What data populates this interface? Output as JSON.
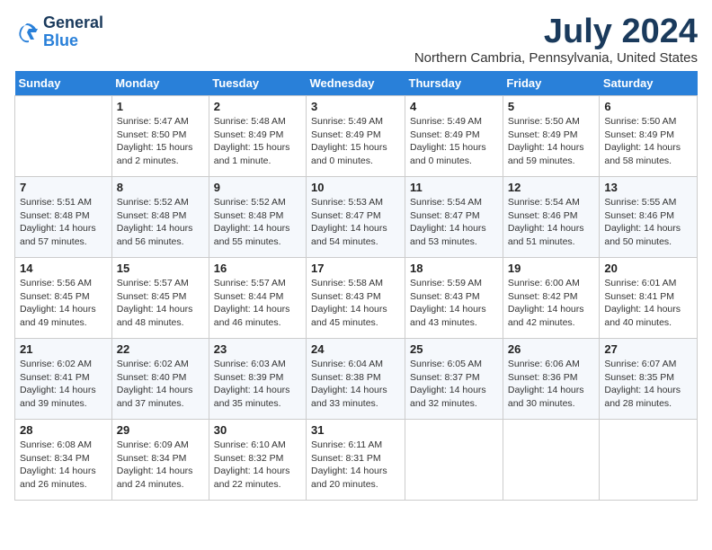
{
  "logo": {
    "general": "General",
    "blue": "Blue"
  },
  "title": "July 2024",
  "location": "Northern Cambria, Pennsylvania, United States",
  "days_of_week": [
    "Sunday",
    "Monday",
    "Tuesday",
    "Wednesday",
    "Thursday",
    "Friday",
    "Saturday"
  ],
  "weeks": [
    [
      {
        "day": "",
        "info": ""
      },
      {
        "day": "1",
        "info": "Sunrise: 5:47 AM\nSunset: 8:50 PM\nDaylight: 15 hours\nand 2 minutes."
      },
      {
        "day": "2",
        "info": "Sunrise: 5:48 AM\nSunset: 8:49 PM\nDaylight: 15 hours\nand 1 minute."
      },
      {
        "day": "3",
        "info": "Sunrise: 5:49 AM\nSunset: 8:49 PM\nDaylight: 15 hours\nand 0 minutes."
      },
      {
        "day": "4",
        "info": "Sunrise: 5:49 AM\nSunset: 8:49 PM\nDaylight: 15 hours\nand 0 minutes."
      },
      {
        "day": "5",
        "info": "Sunrise: 5:50 AM\nSunset: 8:49 PM\nDaylight: 14 hours\nand 59 minutes."
      },
      {
        "day": "6",
        "info": "Sunrise: 5:50 AM\nSunset: 8:49 PM\nDaylight: 14 hours\nand 58 minutes."
      }
    ],
    [
      {
        "day": "7",
        "info": "Sunrise: 5:51 AM\nSunset: 8:48 PM\nDaylight: 14 hours\nand 57 minutes."
      },
      {
        "day": "8",
        "info": "Sunrise: 5:52 AM\nSunset: 8:48 PM\nDaylight: 14 hours\nand 56 minutes."
      },
      {
        "day": "9",
        "info": "Sunrise: 5:52 AM\nSunset: 8:48 PM\nDaylight: 14 hours\nand 55 minutes."
      },
      {
        "day": "10",
        "info": "Sunrise: 5:53 AM\nSunset: 8:47 PM\nDaylight: 14 hours\nand 54 minutes."
      },
      {
        "day": "11",
        "info": "Sunrise: 5:54 AM\nSunset: 8:47 PM\nDaylight: 14 hours\nand 53 minutes."
      },
      {
        "day": "12",
        "info": "Sunrise: 5:54 AM\nSunset: 8:46 PM\nDaylight: 14 hours\nand 51 minutes."
      },
      {
        "day": "13",
        "info": "Sunrise: 5:55 AM\nSunset: 8:46 PM\nDaylight: 14 hours\nand 50 minutes."
      }
    ],
    [
      {
        "day": "14",
        "info": "Sunrise: 5:56 AM\nSunset: 8:45 PM\nDaylight: 14 hours\nand 49 minutes."
      },
      {
        "day": "15",
        "info": "Sunrise: 5:57 AM\nSunset: 8:45 PM\nDaylight: 14 hours\nand 48 minutes."
      },
      {
        "day": "16",
        "info": "Sunrise: 5:57 AM\nSunset: 8:44 PM\nDaylight: 14 hours\nand 46 minutes."
      },
      {
        "day": "17",
        "info": "Sunrise: 5:58 AM\nSunset: 8:43 PM\nDaylight: 14 hours\nand 45 minutes."
      },
      {
        "day": "18",
        "info": "Sunrise: 5:59 AM\nSunset: 8:43 PM\nDaylight: 14 hours\nand 43 minutes."
      },
      {
        "day": "19",
        "info": "Sunrise: 6:00 AM\nSunset: 8:42 PM\nDaylight: 14 hours\nand 42 minutes."
      },
      {
        "day": "20",
        "info": "Sunrise: 6:01 AM\nSunset: 8:41 PM\nDaylight: 14 hours\nand 40 minutes."
      }
    ],
    [
      {
        "day": "21",
        "info": "Sunrise: 6:02 AM\nSunset: 8:41 PM\nDaylight: 14 hours\nand 39 minutes."
      },
      {
        "day": "22",
        "info": "Sunrise: 6:02 AM\nSunset: 8:40 PM\nDaylight: 14 hours\nand 37 minutes."
      },
      {
        "day": "23",
        "info": "Sunrise: 6:03 AM\nSunset: 8:39 PM\nDaylight: 14 hours\nand 35 minutes."
      },
      {
        "day": "24",
        "info": "Sunrise: 6:04 AM\nSunset: 8:38 PM\nDaylight: 14 hours\nand 33 minutes."
      },
      {
        "day": "25",
        "info": "Sunrise: 6:05 AM\nSunset: 8:37 PM\nDaylight: 14 hours\nand 32 minutes."
      },
      {
        "day": "26",
        "info": "Sunrise: 6:06 AM\nSunset: 8:36 PM\nDaylight: 14 hours\nand 30 minutes."
      },
      {
        "day": "27",
        "info": "Sunrise: 6:07 AM\nSunset: 8:35 PM\nDaylight: 14 hours\nand 28 minutes."
      }
    ],
    [
      {
        "day": "28",
        "info": "Sunrise: 6:08 AM\nSunset: 8:34 PM\nDaylight: 14 hours\nand 26 minutes."
      },
      {
        "day": "29",
        "info": "Sunrise: 6:09 AM\nSunset: 8:34 PM\nDaylight: 14 hours\nand 24 minutes."
      },
      {
        "day": "30",
        "info": "Sunrise: 6:10 AM\nSunset: 8:32 PM\nDaylight: 14 hours\nand 22 minutes."
      },
      {
        "day": "31",
        "info": "Sunrise: 6:11 AM\nSunset: 8:31 PM\nDaylight: 14 hours\nand 20 minutes."
      },
      {
        "day": "",
        "info": ""
      },
      {
        "day": "",
        "info": ""
      },
      {
        "day": "",
        "info": ""
      }
    ]
  ]
}
